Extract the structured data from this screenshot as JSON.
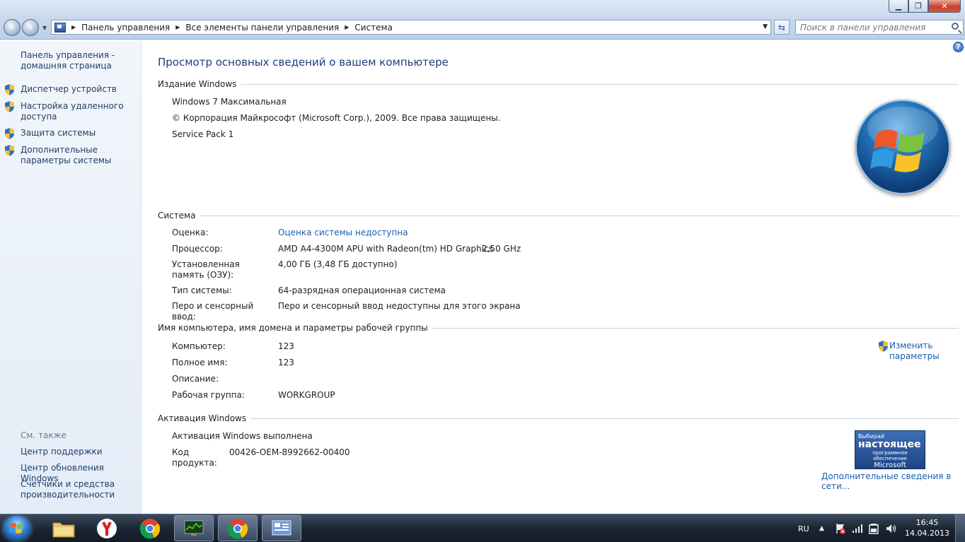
{
  "breadcrumb": {
    "items": [
      "Панель управления",
      "Все элементы панели управления",
      "Система"
    ]
  },
  "search": {
    "placeholder": "Поиск в панели управления"
  },
  "left_nav": {
    "home": "Панель управления - домашняя страница",
    "tasks": [
      "Диспетчер устройств",
      "Настройка удаленного доступа",
      "Защита системы",
      "Дополнительные параметры системы"
    ],
    "see_also_title": "См. также",
    "see_also": [
      "Центр поддержки",
      "Центр обновления Windows",
      "Счетчики и средства производительности"
    ]
  },
  "main": {
    "title": "Просмотр основных сведений о вашем компьютере",
    "edition": {
      "heading": "Издание Windows",
      "name": "Windows 7 Максимальная",
      "copyright": "© Корпорация Майкрософт (Microsoft Corp.), 2009. Все права защищены.",
      "service_pack": "Service Pack 1"
    },
    "system": {
      "heading": "Система",
      "rating_label": "Оценка:",
      "rating_value": "Оценка системы недоступна",
      "cpu_label": "Процессор:",
      "cpu_value": "AMD A4-4300M APU with Radeon(tm) HD Graphics",
      "cpu_freq": "2,50 GHz",
      "ram_label": "Установленная память (ОЗУ):",
      "ram_value": "4,00 ГБ (3,48 ГБ доступно)",
      "type_label": "Тип системы:",
      "type_value": "64-разрядная операционная система",
      "pen_label": "Перо и сенсорный ввод:",
      "pen_value": "Перо и сенсорный ввод недоступны для этого экрана"
    },
    "computer": {
      "heading": "Имя компьютера, имя домена и параметры рабочей группы",
      "name_label": "Компьютер:",
      "name_value": "123",
      "fullname_label": "Полное имя:",
      "fullname_value": "123",
      "desc_label": "Описание:",
      "desc_value": "",
      "workgroup_label": "Рабочая группа:",
      "workgroup_value": "WORKGROUP",
      "change_link": "Изменить параметры"
    },
    "activation": {
      "heading": "Активация Windows",
      "status": "Активация Windows выполнена",
      "key_label": "Код продукта:",
      "key_value": "00426-OEM-8992662-00400",
      "genuine_line1": "Выбирай",
      "genuine_line2": "настоящее",
      "genuine_line3": "программное обеспечение",
      "genuine_line4": "Microsoft",
      "more_info": "Дополнительные сведения в сети..."
    }
  },
  "taskbar": {
    "lang": "RU",
    "time": "16:45",
    "date": "14.04.2013"
  },
  "colors": {
    "link": "#1a5eab",
    "title": "#1e3e7a",
    "nav_link": "#1e3e6b"
  }
}
